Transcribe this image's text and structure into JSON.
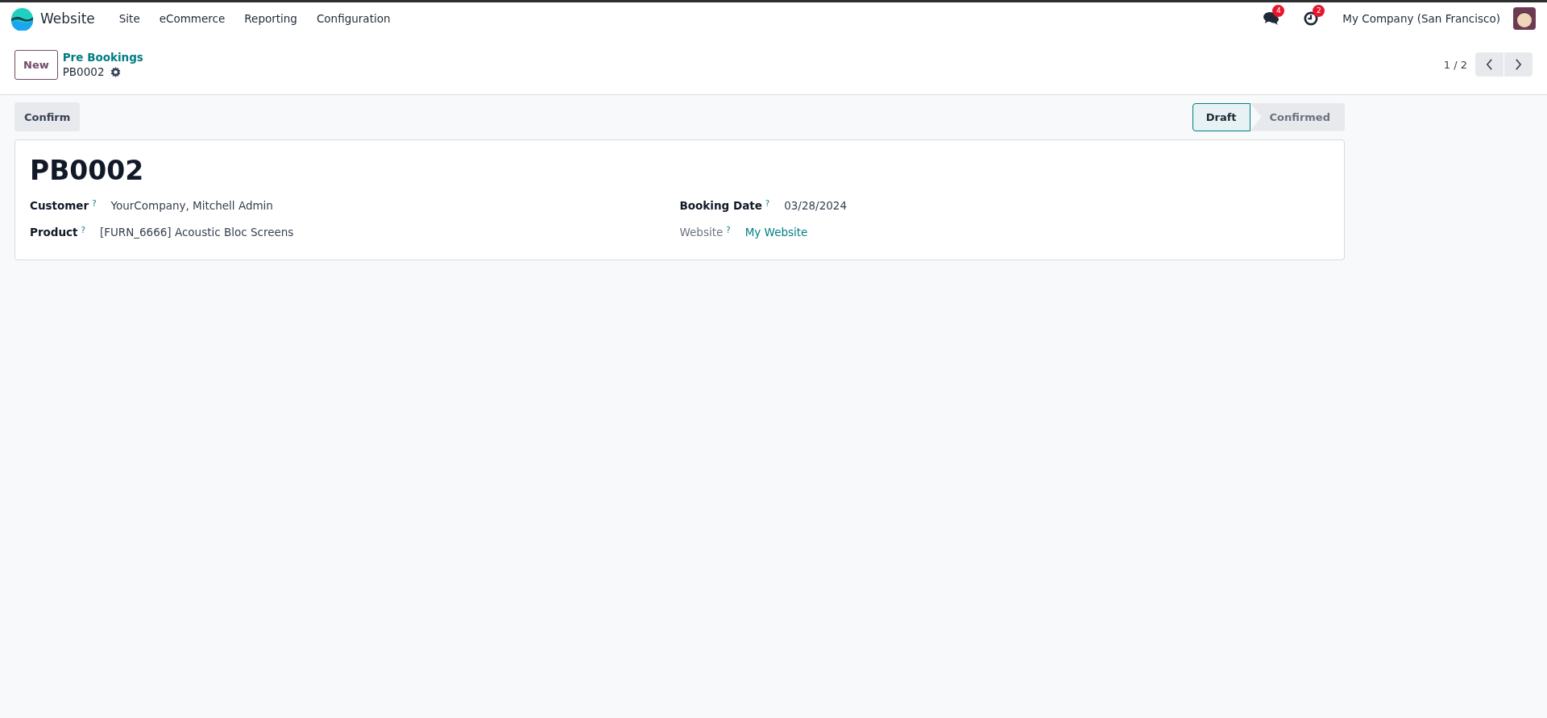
{
  "navbar": {
    "app_name": "Website",
    "menu": [
      "Site",
      "eCommerce",
      "Reporting",
      "Configuration"
    ],
    "messages_count": "4",
    "activities_count": "2",
    "company": "My Company (San Francisco)"
  },
  "control_panel": {
    "new_button": "New",
    "breadcrumb": "Pre Bookings",
    "record": "PB0002",
    "pager": "1 / 2"
  },
  "action_buttons": [
    "Confirm"
  ],
  "stages": [
    {
      "label": "Draft",
      "selected": true
    },
    {
      "label": "Confirmed",
      "selected": false
    }
  ],
  "form": {
    "title": "PB0002",
    "left_fields": [
      {
        "label": "Customer",
        "help": "?",
        "value": "YourCompany, Mitchell Admin",
        "kind": "text",
        "readonly": false
      },
      {
        "label": "Product",
        "help": "?",
        "value": "[FURN_6666] Acoustic Bloc Screens",
        "kind": "text",
        "readonly": false
      }
    ],
    "right_fields": [
      {
        "label": "Booking Date",
        "help": "?",
        "value": "03/28/2024",
        "kind": "text",
        "readonly": false
      },
      {
        "label": "Website",
        "help": "?",
        "value": "My Website",
        "kind": "link",
        "readonly": true
      }
    ]
  }
}
